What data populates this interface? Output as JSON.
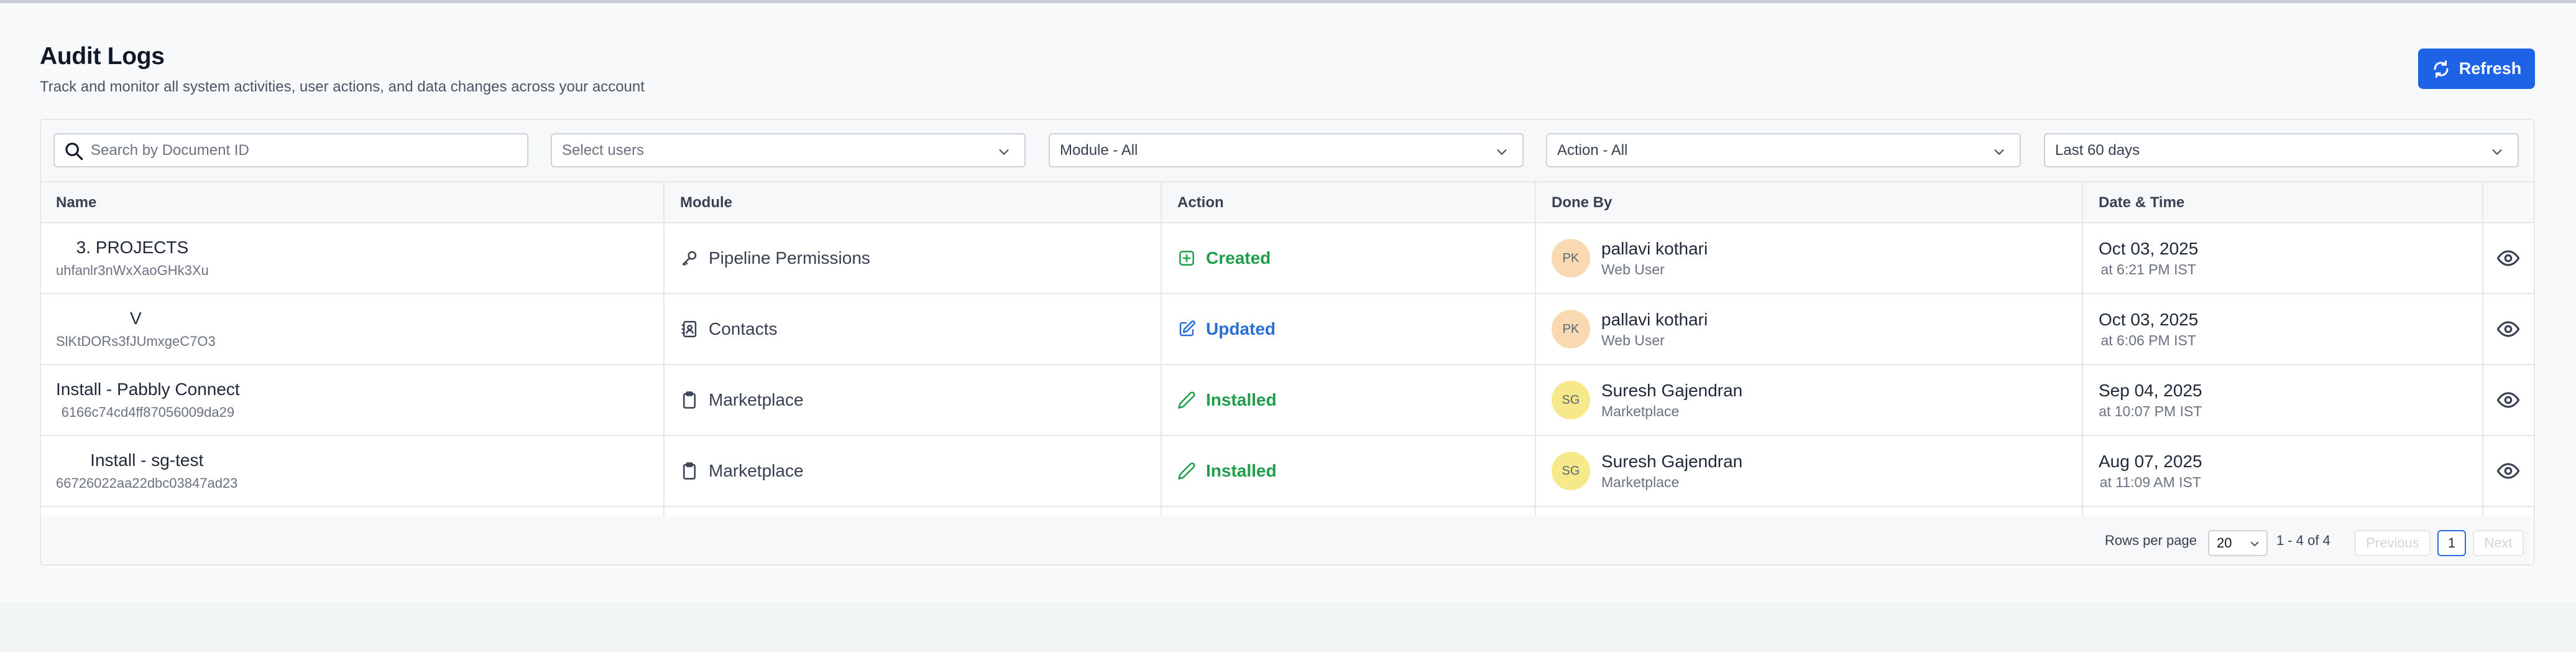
{
  "page": {
    "title": "Audit Logs",
    "subtitle": "Track and monitor all system activities, user actions, and data changes across your account",
    "refresh_label": "Refresh"
  },
  "filters": {
    "search_placeholder": "Search by Document ID",
    "users_placeholder": "Select users",
    "module_value": "Module - All",
    "action_value": "Action - All",
    "date_value": "Last 60 days"
  },
  "table": {
    "columns": [
      "Name",
      "Module",
      "Action",
      "Done By",
      "Date & Time"
    ],
    "rows": [
      {
        "name": "3. PROJECTS",
        "doc_id": "uhfanlr3nWxXaoGHk3Xu",
        "module": "Pipeline Permissions",
        "module_icon": "key-icon",
        "action": "Created",
        "action_icon": "plus-square-icon",
        "action_color": "#1e9e4b",
        "initials": "PK",
        "user": "pallavi kothari",
        "user_source": "Web User",
        "date": "Oct 03, 2025",
        "time": "at 6:21 PM IST"
      },
      {
        "name": "V",
        "doc_id": "SlKtDORs3fJUmxgeC7O3",
        "module": "Contacts",
        "module_icon": "contact-book-icon",
        "action": "Updated",
        "action_icon": "edit-icon",
        "action_color": "#2a6fd6",
        "initials": "PK",
        "user": "pallavi kothari",
        "user_source": "Web User",
        "date": "Oct 03, 2025",
        "time": "at 6:06 PM IST"
      },
      {
        "name": "Install - Pabbly Connect",
        "doc_id": "6166c74cd4ff87056009da29",
        "module": "Marketplace",
        "module_icon": "clipboard-icon",
        "action": "Installed",
        "action_icon": "pencil-icon",
        "action_color": "#1e9e4b",
        "initials": "SG",
        "user": "Suresh Gajendran",
        "user_source": "Marketplace",
        "date": "Sep 04, 2025",
        "time": "at 10:07 PM IST"
      },
      {
        "name": "Install - sg-test",
        "doc_id": "66726022aa22dbc03847ad23",
        "module": "Marketplace",
        "module_icon": "clipboard-icon",
        "action": "Installed",
        "action_icon": "pencil-icon",
        "action_color": "#1e9e4b",
        "initials": "SG",
        "user": "Suresh Gajendran",
        "user_source": "Marketplace",
        "date": "Aug 07, 2025",
        "time": "at 11:09 AM IST"
      }
    ]
  },
  "pagination": {
    "rows_per_page_label": "Rows per page",
    "rows_per_page": "20",
    "range": "1 - 4 of 4",
    "previous": "Previous",
    "current_page": "1",
    "next": "Next"
  },
  "colors": {
    "primary": "#1e63e6",
    "success": "#1e9e4b",
    "info": "#2a6fd6"
  }
}
